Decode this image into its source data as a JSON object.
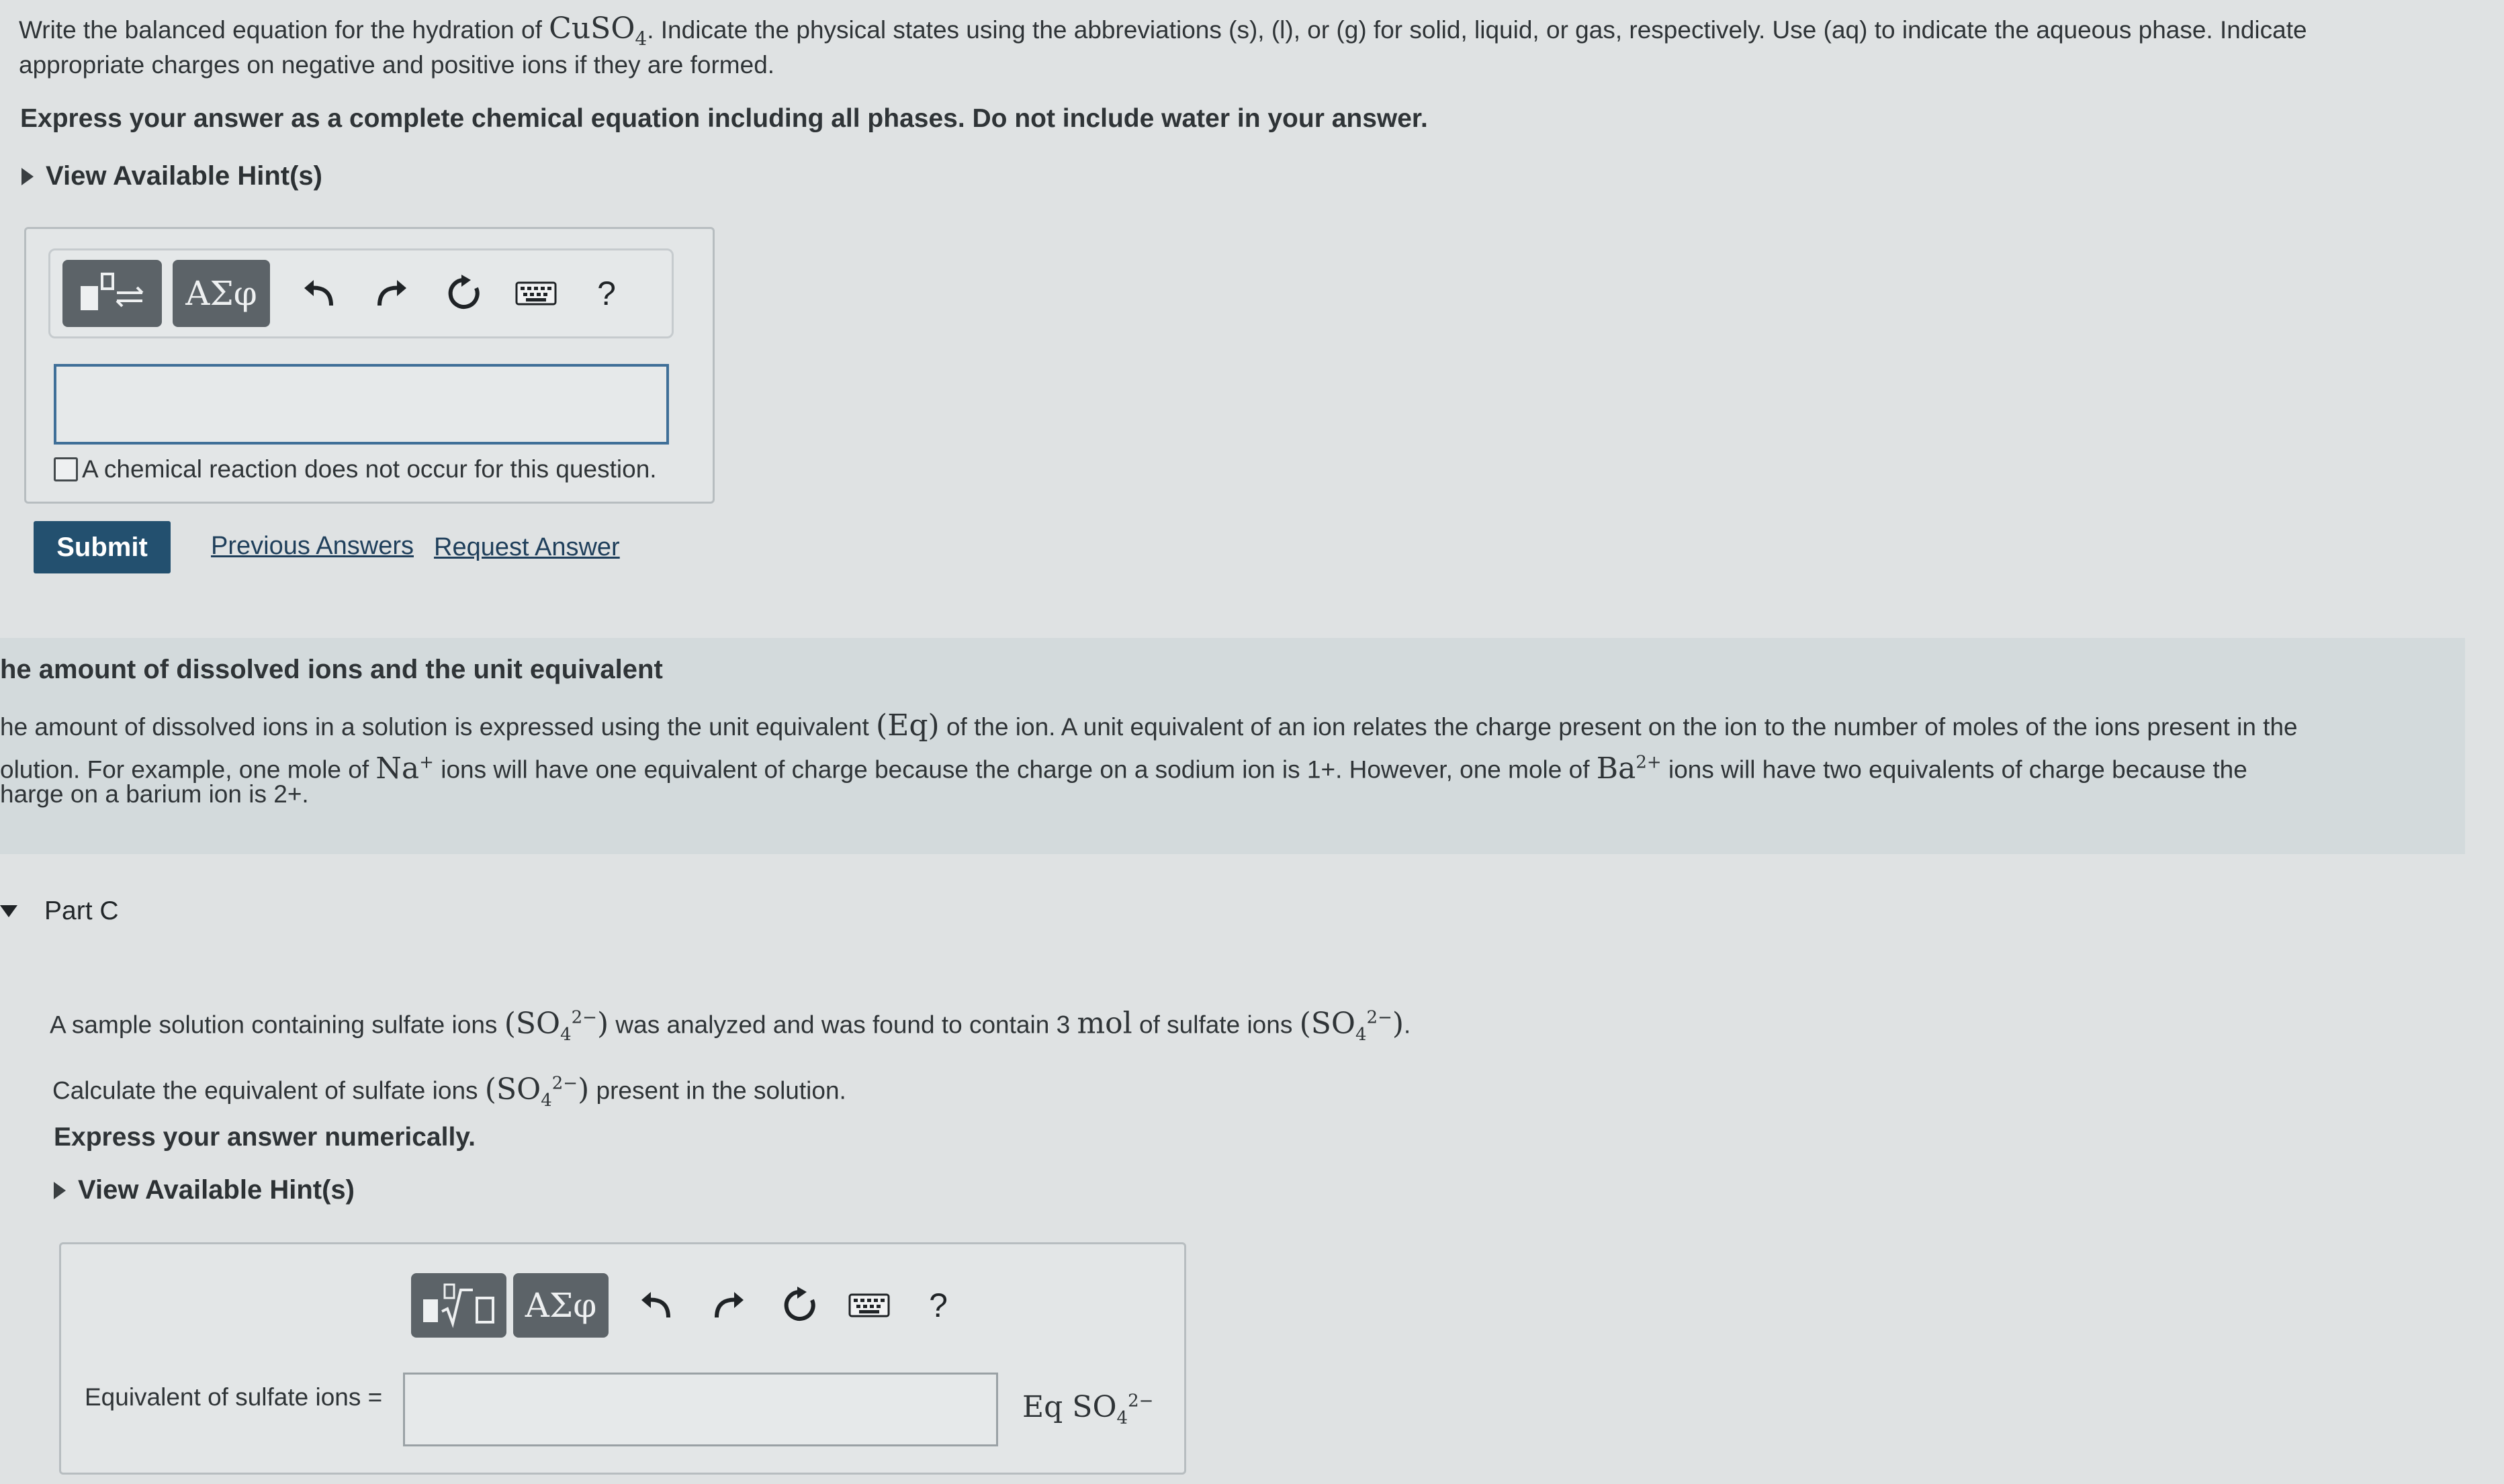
{
  "partB": {
    "question_pre": "Write the balanced equation for the hydration of ",
    "question_formula": "CuSO",
    "question_formula_sub": "4",
    "question_post": ". Indicate the physical states using the abbreviations (s), (l), or (g) for solid, liquid, or gas, respectively. Use (aq) to indicate the aqueous phase. Indicate",
    "question_line2": "appropriate charges on negative and positive ions if they are formed.",
    "instruction": "Express your answer as a complete chemical equation including all phases. Do not include water in your answer.",
    "hint_label": "View Available Hint(s)",
    "toolbar_greek": "ΑΣφ",
    "toolbar_help": "?",
    "answer_value": "",
    "no_reaction_label": "A chemical reaction does not occur for this question.",
    "submit_label": "Submit",
    "previous_answers": "Previous Answers",
    "request_answer": "Request Answer"
  },
  "info": {
    "heading": "he amount of dissolved ions and the unit equivalent",
    "line1_pre": "he amount of dissolved ions in a solution is expressed using the unit equivalent ",
    "line1_eq": "(Eq)",
    "line1_post": " of the ion. A unit equivalent of an ion relates the charge present on the ion to the number of moles of the ions present in the",
    "line2_pre": "olution. For example, one mole of ",
    "line2_na": "Na",
    "line2_na_sup": "+",
    "line2_mid": " ions will have one equivalent of charge because the charge on a sodium ion is 1+. However, one mole of ",
    "line2_ba": "Ba",
    "line2_ba_sup": "2+",
    "line2_post": " ions will have two equivalents of charge because the",
    "line3": "harge on a barium ion is 2+."
  },
  "partC": {
    "title": "Part C",
    "q1_pre": "A sample solution containing sulfate ions ",
    "q1_mid": " was analyzed and was found to contain 3 ",
    "q1_mol": "mol",
    "q1_post": " of sulfate ions ",
    "q2_pre": "Calculate the equivalent of sulfate ions ",
    "q2_post": " present in the solution.",
    "so4": "SO",
    "so4_sub": "4",
    "so4_sup": "2−",
    "instruction": "Express your answer numerically.",
    "hint_label": "View Available Hint(s)",
    "toolbar_greek": "ΑΣφ",
    "toolbar_help": "?",
    "field_label": "Equivalent of sulfate ions =",
    "field_value": "",
    "unit_eq": "Eq",
    "unit_so4": "SO",
    "unit_sub": "4",
    "unit_sup": "2−"
  }
}
